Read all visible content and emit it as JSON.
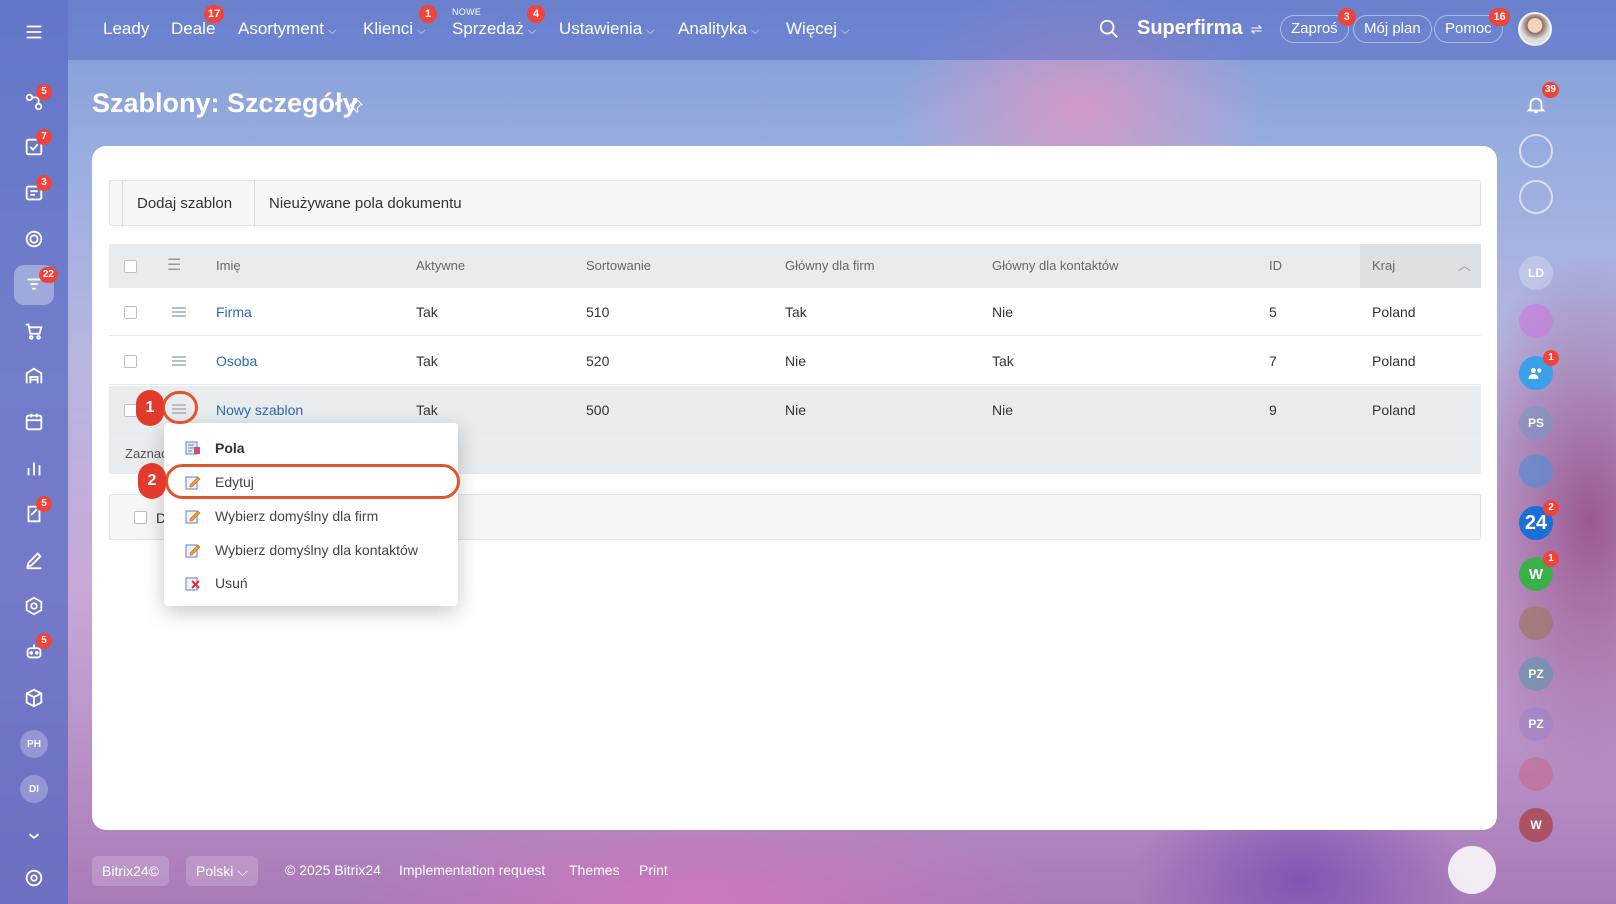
{
  "topnav": {
    "items": [
      {
        "label": "Leady",
        "badge": "",
        "new": "",
        "chevron": false
      },
      {
        "label": "Deale",
        "badge": "17",
        "new": "",
        "chevron": false
      },
      {
        "label": "Asortyment",
        "badge": "",
        "new": "",
        "chevron": true
      },
      {
        "label": "Klienci",
        "badge": "1",
        "new": "",
        "chevron": true
      },
      {
        "label": "Sprzedaż",
        "badge": "4",
        "new": "NOWE",
        "chevron": true
      },
      {
        "label": "Ustawienia",
        "badge": "",
        "new": "",
        "chevron": true
      },
      {
        "label": "Analityka",
        "badge": "",
        "new": "",
        "chevron": true
      },
      {
        "label": "Więcej",
        "badge": "",
        "new": "",
        "chevron": true
      }
    ],
    "brand": "Superfirma",
    "invite_label": "Zaproś",
    "invite_badge": "3",
    "plan_label": "Mój plan",
    "help_label": "Pomoc",
    "help_badge": "16"
  },
  "sidebar": {
    "badges": [
      "5",
      "7",
      "3",
      "",
      "22",
      "",
      "",
      "",
      "",
      "5",
      "",
      "",
      "5",
      ""
    ],
    "avatars": [
      "PH",
      "DI"
    ]
  },
  "page": {
    "title": "Szablony: Szczegóły"
  },
  "toolbar": {
    "add_template": "Dodaj szablon",
    "unused_fields": "Nieużywane pola dokumentu"
  },
  "grid": {
    "columns": [
      "Imię",
      "Aktywne",
      "Sortowanie",
      "Główny dla firm",
      "Główny dla kontaktów",
      "ID",
      "Kraj"
    ],
    "rows": [
      {
        "name": "Firma",
        "active": "Tak",
        "sort": "510",
        "main_company": "Tak",
        "main_contact": "Nie",
        "id": "5",
        "country": "Poland"
      },
      {
        "name": "Osoba",
        "active": "Tak",
        "sort": "520",
        "main_company": "Nie",
        "main_contact": "Tak",
        "id": "7",
        "country": "Poland"
      },
      {
        "name": "Nowy szablon",
        "active": "Tak",
        "sort": "500",
        "main_company": "Nie",
        "main_contact": "Nie",
        "id": "9",
        "country": "Poland"
      }
    ],
    "footer_text": "Zaznac",
    "action_text": "D"
  },
  "context_menu": {
    "items": [
      {
        "label": "Pola",
        "icon": "fields-icon"
      },
      {
        "label": "Edytuj",
        "icon": "edit-icon"
      },
      {
        "label": "Wybierz domyślny dla firm",
        "icon": "edit-icon"
      },
      {
        "label": "Wybierz domyślny dla kontaktów",
        "icon": "edit-icon"
      },
      {
        "label": "Usuń",
        "icon": "delete-icon"
      }
    ]
  },
  "markers": [
    "1",
    "2"
  ],
  "right_rail": {
    "notification_badge": "39",
    "items": [
      {
        "label": "",
        "badge": ""
      },
      {
        "label": "",
        "badge": ""
      },
      {
        "label": "LD",
        "badge": ""
      },
      {
        "label": "",
        "badge": ""
      },
      {
        "label": "",
        "badge": "1"
      },
      {
        "label": "PS",
        "badge": ""
      },
      {
        "label": "",
        "badge": ""
      },
      {
        "label": "24",
        "badge": "2"
      },
      {
        "label": "W",
        "badge": "1"
      },
      {
        "label": "",
        "badge": ""
      },
      {
        "label": "PZ",
        "badge": ""
      },
      {
        "label": "PZ",
        "badge": ""
      },
      {
        "label": "",
        "badge": ""
      },
      {
        "label": "W",
        "badge": ""
      }
    ]
  },
  "page_footer": {
    "logo": "Bitrix24©",
    "language": "Polski",
    "copyright": "© 2025 Bitrix24",
    "implementation": "Implementation request",
    "themes": "Themes",
    "print": "Print"
  }
}
